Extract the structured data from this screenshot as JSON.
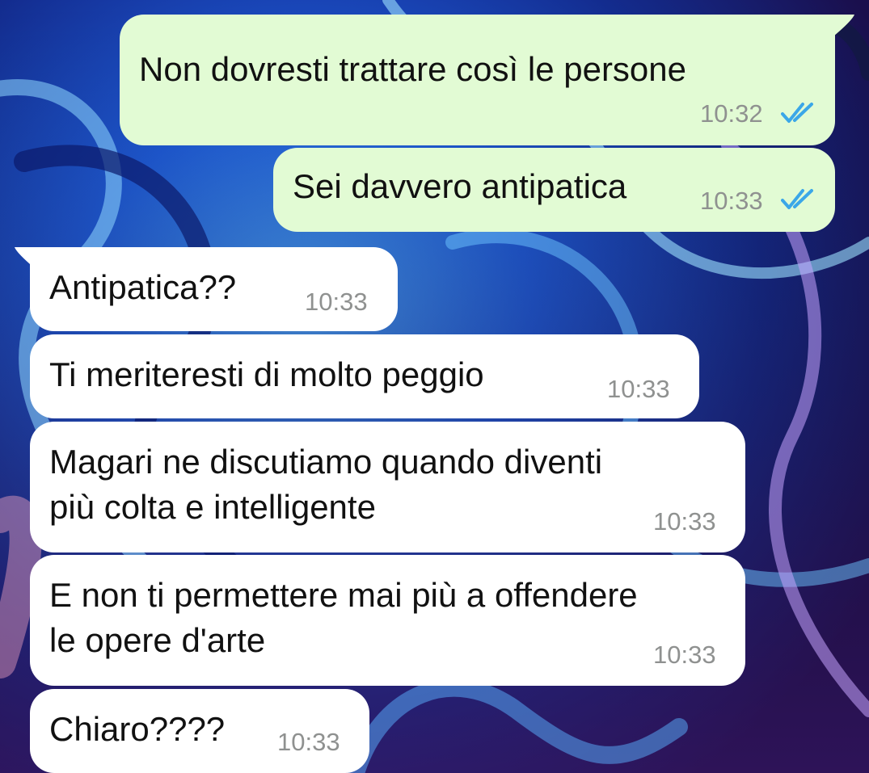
{
  "chat": {
    "status_color_read_ticks": "#3ba7e8",
    "outgoing_bubble_color": "#e2fbd4",
    "incoming_bubble_color": "#ffffff",
    "messages": [
      {
        "direction": "outgoing",
        "text": "Non dovresti trattare così le persone",
        "time": "10:32",
        "status": "read",
        "status_icon": "double-check-icon"
      },
      {
        "direction": "outgoing",
        "text": "Sei davvero antipatica",
        "time": "10:33",
        "status": "read",
        "status_icon": "double-check-icon"
      },
      {
        "direction": "incoming",
        "text": "Antipatica??",
        "time": "10:33"
      },
      {
        "direction": "incoming",
        "text": "Ti meriteresti di molto peggio",
        "time": "10:33"
      },
      {
        "direction": "incoming",
        "lines": [
          "Magari ne discutiamo quando diventi",
          "più colta e intelligente"
        ],
        "time": "10:33"
      },
      {
        "direction": "incoming",
        "lines": [
          "E non ti permettere mai più a offendere",
          "le opere d'arte"
        ],
        "time": "10:33"
      },
      {
        "direction": "incoming",
        "text": "Chiaro????",
        "time": "10:33"
      }
    ]
  }
}
